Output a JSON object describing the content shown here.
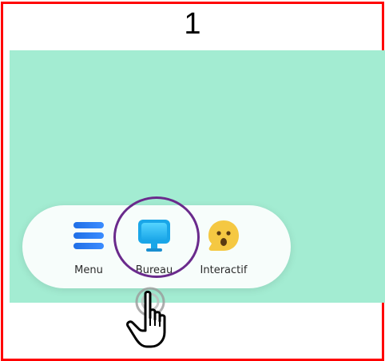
{
  "step": {
    "number": "1"
  },
  "colors": {
    "frame_border": "#ff0000",
    "desktop_background": "#a3ecd2",
    "highlight_ring": "#6a2a8c"
  },
  "dock": {
    "items": [
      {
        "label": "Menu",
        "icon": "menu-icon"
      },
      {
        "label": "Bureau",
        "icon": "desktop-monitor-icon"
      },
      {
        "label": "Interactif",
        "icon": "interactive-face-icon"
      }
    ]
  }
}
